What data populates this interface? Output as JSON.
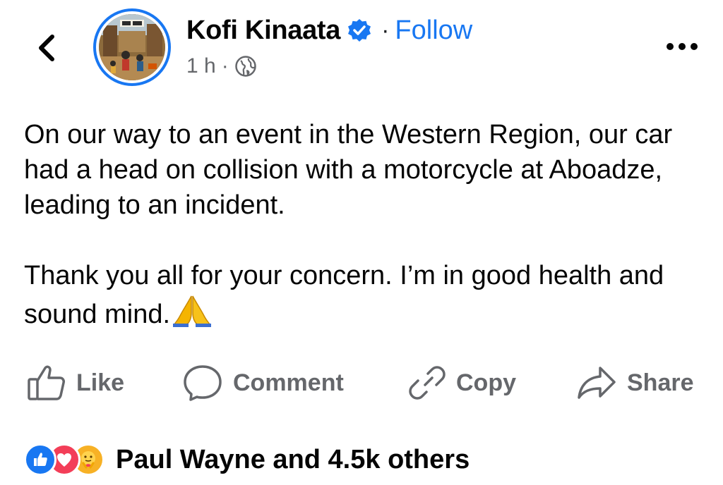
{
  "header": {
    "author_name": "Kofi Kinaata",
    "separator": "·",
    "follow_label": "Follow",
    "timestamp": "1 h",
    "meta_separator": "·",
    "back_icon": "chevron-left-icon",
    "more_icon": "more-horizontal-icon",
    "privacy_icon": "globe-icon",
    "verified_icon": "verified-badge-icon"
  },
  "post": {
    "paragraph_1": "On our way to an event in the Western Region, our car had a head on collision with a motorcycle at Aboadze, leading to an incident.",
    "paragraph_2": "Thank you all for your concern. I’m in good health and sound mind.",
    "emoji": "folded-hands-emoji"
  },
  "actions": {
    "like_label": "Like",
    "comment_label": "Comment",
    "copy_label": "Copy",
    "share_label": "Share"
  },
  "reactions": {
    "summary": "Paul Wayne and 4.5k others",
    "icons": [
      "like-reaction-icon",
      "love-reaction-icon",
      "care-reaction-icon"
    ]
  },
  "colors": {
    "accent": "#1877f2",
    "secondary_text": "#65676b",
    "love": "#f33e58",
    "care": "#f7b125"
  }
}
